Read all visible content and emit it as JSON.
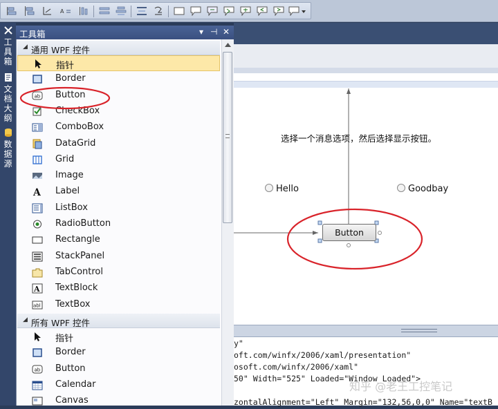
{
  "toolbox": {
    "title": "工具箱",
    "title_buttons": [
      "▾",
      "⊣",
      "✕"
    ],
    "category_common": "通用 WPF 控件",
    "common_items": [
      {
        "label": "指针",
        "icon": "pointer-icon",
        "selected": true
      },
      {
        "label": "Border",
        "icon": "border-icon"
      },
      {
        "label": "Button",
        "icon": "button-icon"
      },
      {
        "label": "CheckBox",
        "icon": "checkbox-icon"
      },
      {
        "label": "ComboBox",
        "icon": "combobox-icon"
      },
      {
        "label": "DataGrid",
        "icon": "datagrid-icon"
      },
      {
        "label": "Grid",
        "icon": "grid-icon"
      },
      {
        "label": "Image",
        "icon": "image-icon"
      },
      {
        "label": "Label",
        "icon": "label-icon"
      },
      {
        "label": "ListBox",
        "icon": "listbox-icon"
      },
      {
        "label": "RadioButton",
        "icon": "radiobutton-icon"
      },
      {
        "label": "Rectangle",
        "icon": "rectangle-icon"
      },
      {
        "label": "StackPanel",
        "icon": "stackpanel-icon"
      },
      {
        "label": "TabControl",
        "icon": "tabcontrol-icon"
      },
      {
        "label": "TextBlock",
        "icon": "textblock-icon"
      },
      {
        "label": "TextBox",
        "icon": "textbox-icon"
      }
    ],
    "category_all": "所有 WPF 控件",
    "all_items": [
      {
        "label": "指针",
        "icon": "pointer-icon"
      },
      {
        "label": "Border",
        "icon": "border-icon"
      },
      {
        "label": "Button",
        "icon": "button-icon"
      },
      {
        "label": "Calendar",
        "icon": "calendar-icon"
      },
      {
        "label": "Canvas",
        "icon": "canvas-icon"
      }
    ]
  },
  "sidebar_tabs": [
    "工具箱",
    "文档大纲",
    "数据源"
  ],
  "designer": {
    "prompt_text": "选择一个消息选项，然后选择显示按钮。",
    "radio_hello": "Hello",
    "radio_goodbye": "Goodbay",
    "button_label": "Button"
  },
  "xaml_lines": [
    "y\"",
    "oft.com/winfx/2006/xaml/presentation\"",
    "osoft.com/winfx/2006/xaml\"",
    "50\" Width=\"525\" Loaded=\"Window_Loaded\">",
    "",
    "zontalAlignment=\"Left\" Margin=\"132,56,0,0\" Name=\"textB"
  ],
  "watermark": "知乎 @老王工控笔记",
  "colors": {
    "accent_red": "#d9232a",
    "selection": "#fde8a8",
    "title_bar": "#4a6396"
  }
}
